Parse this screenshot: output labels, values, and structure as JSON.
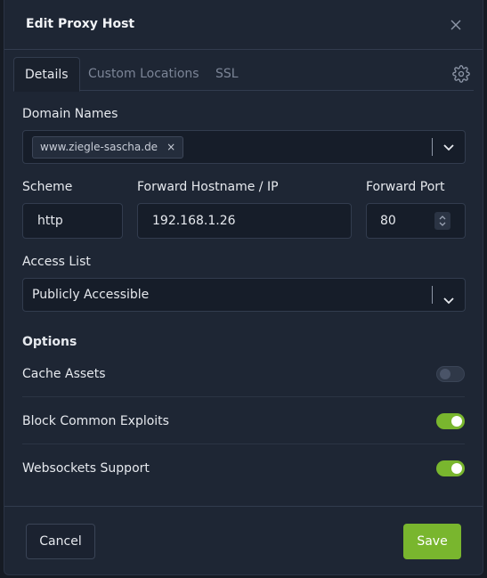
{
  "dialog": {
    "title": "Edit Proxy Host"
  },
  "tabs": [
    {
      "label": "Details",
      "active": true
    },
    {
      "label": "Custom Locations",
      "active": false
    },
    {
      "label": "SSL",
      "active": false
    }
  ],
  "domain_names": {
    "label": "Domain Names",
    "chips": [
      {
        "text": "www.ziegle-sascha.de",
        "remove": "×"
      }
    ]
  },
  "scheme": {
    "label": "Scheme",
    "value": "http"
  },
  "forward_host": {
    "label": "Forward Hostname / IP",
    "value": "192.168.1.26"
  },
  "forward_port": {
    "label": "Forward Port",
    "value": "80"
  },
  "access_list": {
    "label": "Access List",
    "value": "Publicly Accessible"
  },
  "options": {
    "heading": "Options",
    "items": [
      {
        "label": "Cache Assets",
        "enabled": false
      },
      {
        "label": "Block Common Exploits",
        "enabled": true
      },
      {
        "label": "Websockets Support",
        "enabled": true
      }
    ]
  },
  "footer": {
    "cancel_label": "Cancel",
    "save_label": "Save"
  },
  "colors": {
    "accent": "#79b62e",
    "background": "#1e2634",
    "field": "#161d29"
  }
}
